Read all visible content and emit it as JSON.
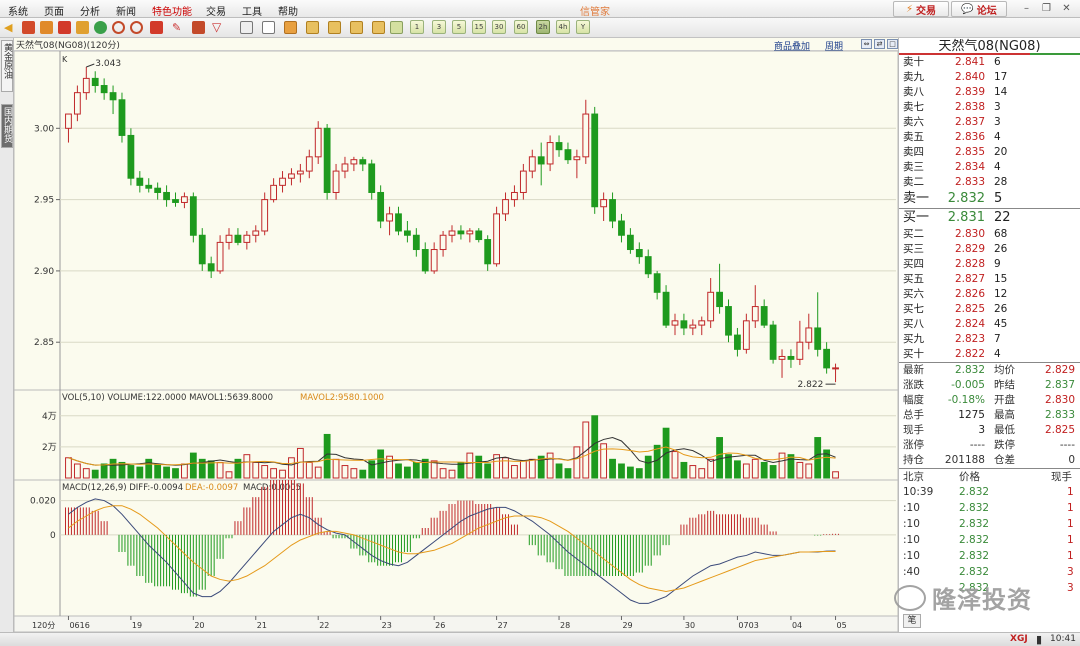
{
  "menu": {
    "items": [
      "系统",
      "页面",
      "分析",
      "新闻",
      "特色功能",
      "交易",
      "工具",
      "帮助"
    ],
    "app_title": "信管家",
    "trade_button": "交易",
    "forum_button": "论坛"
  },
  "toolbar": {
    "periods": [
      "1",
      "3",
      "5",
      "15",
      "30",
      "60",
      "2h",
      "4h",
      "Y"
    ],
    "selected_period": "2h"
  },
  "left_tabs": [
    "黄金原油",
    "国内期货"
  ],
  "chart": {
    "title": "天然气08(NG08)(120分)",
    "overlay_link": "商品叠加",
    "cycle_link": "周期",
    "k_label": "K",
    "high_label": "3.043",
    "low_label": "2.822",
    "price_ticks": [
      "3.00",
      "2.95",
      "2.90",
      "2.85"
    ],
    "vol_header": {
      "prefix": "VOL(5,10)",
      "volume": "VOLUME:122.0000",
      "mavol1": "MAVOL1:5639.8000",
      "mavol2": "MAVOL2:9580.1000"
    },
    "vol_ticks": [
      "4万",
      "2万"
    ],
    "macd_header": {
      "prefix": "MACD(12,26,9)",
      "diff": "DIFF:-0.0094",
      "dea": "DEA:-0.0097",
      "macd": "MACD:0.0005"
    },
    "macd_ticks": [
      "0.020",
      "0"
    ],
    "period_label": "120分",
    "x_ticks": [
      "0616",
      "19",
      "20",
      "21",
      "22",
      "23",
      "26",
      "27",
      "28",
      "29",
      "30",
      "0703",
      "04",
      "05"
    ]
  },
  "chart_data": {
    "type": "candlestick",
    "symbol": "天然气08(NG08)",
    "period": "120分",
    "price_range": [
      2.82,
      3.05
    ],
    "high": 3.043,
    "low": 2.822,
    "volume_range": [
      0,
      45000
    ],
    "macd_range": [
      -0.045,
      0.025
    ],
    "ohlc": [
      [
        3.0,
        3.01,
        2.99,
        3.01
      ],
      [
        3.01,
        3.03,
        3.005,
        3.025
      ],
      [
        3.025,
        3.043,
        3.02,
        3.035
      ],
      [
        3.035,
        3.04,
        3.025,
        3.03
      ],
      [
        3.03,
        3.035,
        3.02,
        3.025
      ],
      [
        3.025,
        3.03,
        3.01,
        3.02
      ],
      [
        3.02,
        3.025,
        2.99,
        2.995
      ],
      [
        2.995,
        3.0,
        2.96,
        2.965
      ],
      [
        2.965,
        2.97,
        2.955,
        2.96
      ],
      [
        2.96,
        2.965,
        2.955,
        2.958
      ],
      [
        2.958,
        2.962,
        2.95,
        2.955
      ],
      [
        2.955,
        2.96,
        2.945,
        2.95
      ],
      [
        2.95,
        2.955,
        2.945,
        2.948
      ],
      [
        2.948,
        2.955,
        2.944,
        2.952
      ],
      [
        2.952,
        2.955,
        2.92,
        2.925
      ],
      [
        2.925,
        2.93,
        2.9,
        2.905
      ],
      [
        2.905,
        2.91,
        2.895,
        2.9
      ],
      [
        2.9,
        2.925,
        2.898,
        2.92
      ],
      [
        2.92,
        2.93,
        2.915,
        2.925
      ],
      [
        2.925,
        2.93,
        2.918,
        2.92
      ],
      [
        2.92,
        2.928,
        2.915,
        2.925
      ],
      [
        2.925,
        2.932,
        2.92,
        2.928
      ],
      [
        2.928,
        2.955,
        2.925,
        2.95
      ],
      [
        2.95,
        2.965,
        2.948,
        2.96
      ],
      [
        2.96,
        2.97,
        2.955,
        2.965
      ],
      [
        2.965,
        2.972,
        2.96,
        2.968
      ],
      [
        2.968,
        2.975,
        2.962,
        2.97
      ],
      [
        2.97,
        2.985,
        2.965,
        2.98
      ],
      [
        2.98,
        3.005,
        2.975,
        3.0
      ],
      [
        3.0,
        3.003,
        2.95,
        2.955
      ],
      [
        2.955,
        2.975,
        2.95,
        2.97
      ],
      [
        2.97,
        2.98,
        2.965,
        2.975
      ],
      [
        2.975,
        2.98,
        2.97,
        2.978
      ],
      [
        2.978,
        2.98,
        2.97,
        2.975
      ],
      [
        2.975,
        2.978,
        2.95,
        2.955
      ],
      [
        2.955,
        2.96,
        2.93,
        2.935
      ],
      [
        2.935,
        2.945,
        2.925,
        2.94
      ],
      [
        2.94,
        2.945,
        2.925,
        2.928
      ],
      [
        2.928,
        2.935,
        2.92,
        2.925
      ],
      [
        2.925,
        2.93,
        2.91,
        2.915
      ],
      [
        2.915,
        2.92,
        2.898,
        2.9
      ],
      [
        2.9,
        2.92,
        2.898,
        2.915
      ],
      [
        2.915,
        2.928,
        2.91,
        2.925
      ],
      [
        2.925,
        2.932,
        2.92,
        2.928
      ],
      [
        2.928,
        2.932,
        2.922,
        2.926
      ],
      [
        2.926,
        2.93,
        2.92,
        2.928
      ],
      [
        2.928,
        2.93,
        2.92,
        2.922
      ],
      [
        2.922,
        2.925,
        2.9,
        2.905
      ],
      [
        2.905,
        2.945,
        2.903,
        2.94
      ],
      [
        2.94,
        2.955,
        2.935,
        2.95
      ],
      [
        2.95,
        2.96,
        2.945,
        2.955
      ],
      [
        2.955,
        2.975,
        2.95,
        2.97
      ],
      [
        2.97,
        2.985,
        2.965,
        2.98
      ],
      [
        2.98,
        2.99,
        2.96,
        2.975
      ],
      [
        2.975,
        2.995,
        2.97,
        2.99
      ],
      [
        2.99,
        2.995,
        2.98,
        2.985
      ],
      [
        2.985,
        2.99,
        2.975,
        2.978
      ],
      [
        2.978,
        2.985,
        2.965,
        2.98
      ],
      [
        2.98,
        3.02,
        2.975,
        3.01
      ],
      [
        3.01,
        3.015,
        2.94,
        2.945
      ],
      [
        2.945,
        2.955,
        2.935,
        2.95
      ],
      [
        2.95,
        2.955,
        2.93,
        2.935
      ],
      [
        2.935,
        2.94,
        2.92,
        2.925
      ],
      [
        2.925,
        2.93,
        2.912,
        2.915
      ],
      [
        2.915,
        2.92,
        2.905,
        2.91
      ],
      [
        2.91,
        2.915,
        2.895,
        2.898
      ],
      [
        2.898,
        2.9,
        2.88,
        2.885
      ],
      [
        2.885,
        2.89,
        2.86,
        2.862
      ],
      [
        2.862,
        2.87,
        2.855,
        2.865
      ],
      [
        2.865,
        2.87,
        2.855,
        2.86
      ],
      [
        2.86,
        2.866,
        2.855,
        2.862
      ],
      [
        2.862,
        2.868,
        2.855,
        2.865
      ],
      [
        2.865,
        2.895,
        2.86,
        2.885
      ],
      [
        2.885,
        2.905,
        2.87,
        2.875
      ],
      [
        2.875,
        2.88,
        2.85,
        2.855
      ],
      [
        2.855,
        2.86,
        2.84,
        2.845
      ],
      [
        2.845,
        2.87,
        2.842,
        2.865
      ],
      [
        2.865,
        2.89,
        2.86,
        2.875
      ],
      [
        2.875,
        2.88,
        2.86,
        2.862
      ],
      [
        2.862,
        2.865,
        2.835,
        2.838
      ],
      [
        2.838,
        2.845,
        2.825,
        2.84
      ],
      [
        2.84,
        2.845,
        2.832,
        2.838
      ],
      [
        2.838,
        2.865,
        2.834,
        2.85
      ],
      [
        2.85,
        2.87,
        2.845,
        2.86
      ],
      [
        2.86,
        2.885,
        2.84,
        2.845
      ],
      [
        2.845,
        2.85,
        2.828,
        2.832
      ],
      [
        2.832,
        2.835,
        2.822,
        2.832
      ]
    ],
    "volume": [
      13000,
      9000,
      6000,
      5000,
      9000,
      12000,
      10000,
      8000,
      7000,
      12000,
      9000,
      7000,
      6000,
      9000,
      16000,
      12000,
      11000,
      10000,
      4000,
      12000,
      15000,
      10000,
      8000,
      6000,
      5000,
      13000,
      19000,
      10000,
      7000,
      28000,
      12000,
      8000,
      6000,
      5000,
      11000,
      18000,
      14000,
      9000,
      7000,
      10000,
      12000,
      11000,
      6000,
      5000,
      10000,
      16000,
      14000,
      9000,
      15000,
      13000,
      8000,
      11000,
      12000,
      14000,
      16000,
      9000,
      6000,
      20000,
      36000,
      40000,
      22000,
      12000,
      9000,
      7000,
      6000,
      14000,
      21000,
      32000,
      17000,
      10000,
      8000,
      6000,
      12000,
      26000,
      15000,
      11000,
      9000,
      12000,
      10000,
      8000,
      16000,
      15000,
      10000,
      9000,
      26000,
      18000,
      4000
    ],
    "macd_diff": [
      0.012,
      0.016,
      0.019,
      0.021,
      0.02,
      0.017,
      0.012,
      0.006,
      0.0,
      -0.006,
      -0.011,
      -0.016,
      -0.022,
      -0.028,
      -0.034,
      -0.036,
      -0.036,
      -0.033,
      -0.028,
      -0.022,
      -0.016,
      -0.01,
      -0.004,
      0.002,
      0.006,
      0.01,
      0.012,
      0.01,
      0.006,
      0.003,
      0.001,
      0.0,
      -0.004,
      -0.008,
      -0.012,
      -0.015,
      -0.017,
      -0.018,
      -0.016,
      -0.012,
      -0.008,
      -0.004,
      0.0,
      0.004,
      0.008,
      0.011,
      0.013,
      0.015,
      0.016,
      0.016,
      0.014,
      0.011,
      0.008,
      0.004,
      0.0,
      -0.005,
      -0.01,
      -0.014,
      -0.018,
      -0.022,
      -0.026,
      -0.03,
      -0.034,
      -0.038,
      -0.04,
      -0.04,
      -0.038,
      -0.036,
      -0.032,
      -0.028,
      -0.024,
      -0.021,
      -0.018,
      -0.017,
      -0.015,
      -0.013,
      -0.012,
      -0.01,
      -0.011,
      -0.012,
      -0.012,
      -0.011,
      -0.01,
      -0.01,
      -0.01,
      -0.0095,
      -0.0094
    ],
    "macd_dea": [
      0.004,
      0.008,
      0.011,
      0.014,
      0.016,
      0.017,
      0.017,
      0.015,
      0.012,
      0.008,
      0.004,
      -0.001,
      -0.006,
      -0.011,
      -0.016,
      -0.02,
      -0.024,
      -0.026,
      -0.027,
      -0.026,
      -0.024,
      -0.021,
      -0.018,
      -0.014,
      -0.01,
      -0.006,
      -0.003,
      -0.001,
      0.001,
      0.002,
      0.002,
      0.001,
      0.0,
      -0.002,
      -0.004,
      -0.006,
      -0.008,
      -0.01,
      -0.011,
      -0.011,
      -0.01,
      -0.009,
      -0.007,
      -0.005,
      -0.002,
      0.001,
      0.004,
      0.006,
      0.008,
      0.01,
      0.011,
      0.011,
      0.011,
      0.01,
      0.008,
      0.005,
      0.002,
      -0.002,
      -0.006,
      -0.01,
      -0.014,
      -0.018,
      -0.022,
      -0.026,
      -0.029,
      -0.031,
      -0.032,
      -0.033,
      -0.032,
      -0.031,
      -0.029,
      -0.027,
      -0.025,
      -0.023,
      -0.021,
      -0.019,
      -0.017,
      -0.015,
      -0.014,
      -0.013,
      -0.012,
      -0.011,
      -0.01,
      -0.01,
      -0.0098,
      -0.0097,
      -0.0097
    ]
  },
  "order_book": {
    "title": "天然气08(NG08)",
    "sells": [
      {
        "label": "卖十",
        "price": "2.841",
        "vol": "6"
      },
      {
        "label": "卖九",
        "price": "2.840",
        "vol": "17"
      },
      {
        "label": "卖八",
        "price": "2.839",
        "vol": "14"
      },
      {
        "label": "卖七",
        "price": "2.838",
        "vol": "3"
      },
      {
        "label": "卖六",
        "price": "2.837",
        "vol": "3"
      },
      {
        "label": "卖五",
        "price": "2.836",
        "vol": "4"
      },
      {
        "label": "卖四",
        "price": "2.835",
        "vol": "20"
      },
      {
        "label": "卖三",
        "price": "2.834",
        "vol": "4"
      },
      {
        "label": "卖二",
        "price": "2.833",
        "vol": "28"
      },
      {
        "label": "卖一",
        "price": "2.832",
        "vol": "5"
      }
    ],
    "buys": [
      {
        "label": "买一",
        "price": "2.831",
        "vol": "22"
      },
      {
        "label": "买二",
        "price": "2.830",
        "vol": "68"
      },
      {
        "label": "买三",
        "price": "2.829",
        "vol": "26"
      },
      {
        "label": "买四",
        "price": "2.828",
        "vol": "9"
      },
      {
        "label": "买五",
        "price": "2.827",
        "vol": "15"
      },
      {
        "label": "买六",
        "price": "2.826",
        "vol": "12"
      },
      {
        "label": "买七",
        "price": "2.825",
        "vol": "26"
      },
      {
        "label": "买八",
        "price": "2.824",
        "vol": "45"
      },
      {
        "label": "买九",
        "price": "2.823",
        "vol": "7"
      },
      {
        "label": "买十",
        "price": "2.822",
        "vol": "4"
      }
    ],
    "stats": [
      [
        "最新",
        "2.832",
        "均价",
        "2.829"
      ],
      [
        "涨跌",
        "-0.005",
        "昨结",
        "2.837"
      ],
      [
        "幅度",
        "-0.18%",
        "开盘",
        "2.830"
      ],
      [
        "总手",
        "1275",
        "最高",
        "2.833"
      ],
      [
        "现手",
        "3",
        "最低",
        "2.825"
      ],
      [
        "涨停",
        "----",
        "跌停",
        "----"
      ],
      [
        "持仓",
        "201188",
        "仓差",
        "0"
      ]
    ],
    "trades_header": [
      "北京",
      "价格",
      "现手"
    ],
    "trades": [
      {
        "time": "10:39",
        "price": "2.832",
        "vol": "1"
      },
      {
        "time": ":10",
        "price": "2.832",
        "vol": "1"
      },
      {
        "time": ":10",
        "price": "2.832",
        "vol": "1"
      },
      {
        "time": ":10",
        "price": "2.832",
        "vol": "1"
      },
      {
        "time": ":10",
        "price": "2.832",
        "vol": "1"
      },
      {
        "time": ":40",
        "price": "2.832",
        "vol": "3"
      },
      {
        "time": "",
        "price": "2.832",
        "vol": "3"
      }
    ],
    "bottom_tab": "笔"
  },
  "status": {
    "brand": "XGJ",
    "time": "10:41"
  },
  "watermark": "隆泽投资",
  "colors": {
    "up": "#c0282a",
    "down": "#1e9a1e",
    "background": "#fbfbee",
    "grid": "#d9d9c6",
    "diff_line": "#3b4a7a",
    "dea_line": "#e59a1a"
  }
}
